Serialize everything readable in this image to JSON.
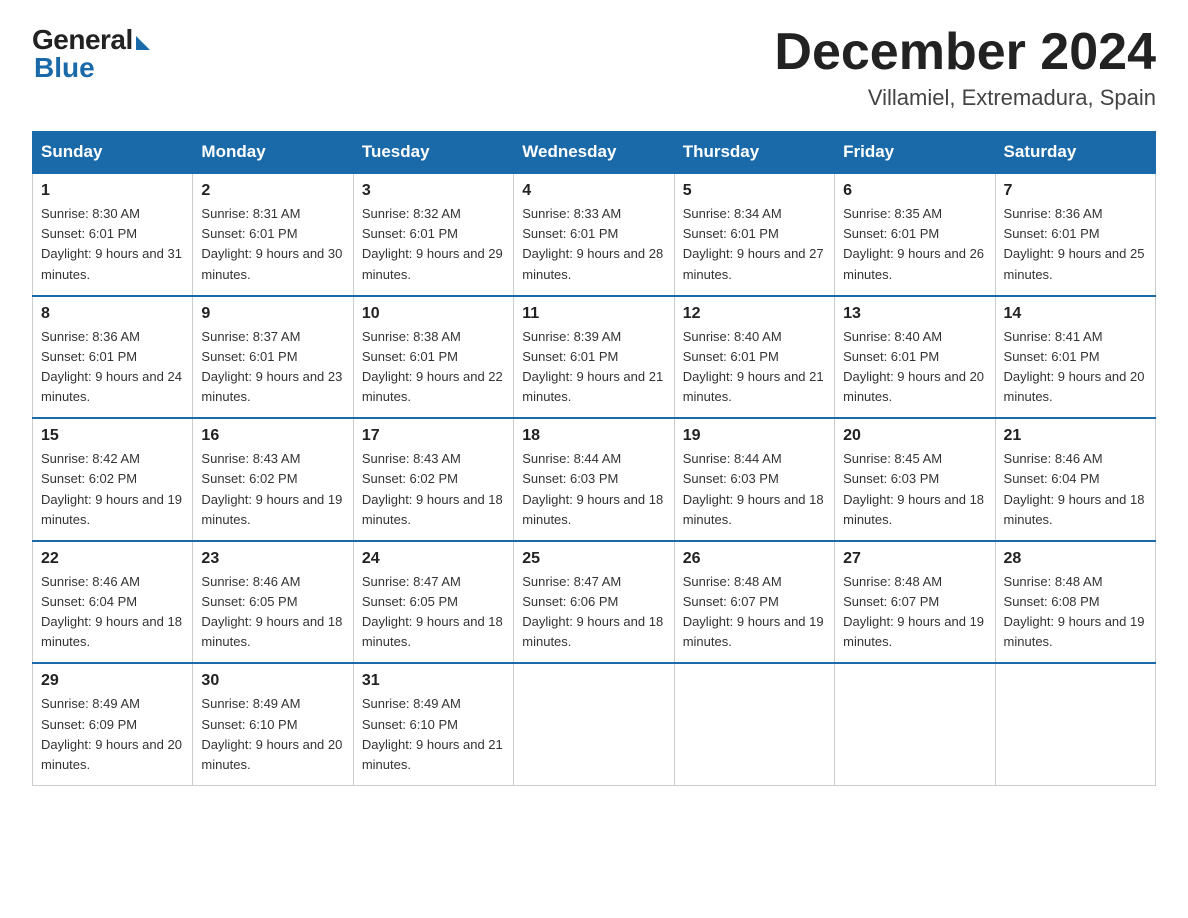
{
  "header": {
    "title": "December 2024",
    "subtitle": "Villamiel, Extremadura, Spain",
    "logo_general": "General",
    "logo_blue": "Blue"
  },
  "columns": [
    "Sunday",
    "Monday",
    "Tuesday",
    "Wednesday",
    "Thursday",
    "Friday",
    "Saturday"
  ],
  "weeks": [
    [
      {
        "day": "1",
        "info": "Sunrise: 8:30 AM\nSunset: 6:01 PM\nDaylight: 9 hours\nand 31 minutes."
      },
      {
        "day": "2",
        "info": "Sunrise: 8:31 AM\nSunset: 6:01 PM\nDaylight: 9 hours\nand 30 minutes."
      },
      {
        "day": "3",
        "info": "Sunrise: 8:32 AM\nSunset: 6:01 PM\nDaylight: 9 hours\nand 29 minutes."
      },
      {
        "day": "4",
        "info": "Sunrise: 8:33 AM\nSunset: 6:01 PM\nDaylight: 9 hours\nand 28 minutes."
      },
      {
        "day": "5",
        "info": "Sunrise: 8:34 AM\nSunset: 6:01 PM\nDaylight: 9 hours\nand 27 minutes."
      },
      {
        "day": "6",
        "info": "Sunrise: 8:35 AM\nSunset: 6:01 PM\nDaylight: 9 hours\nand 26 minutes."
      },
      {
        "day": "7",
        "info": "Sunrise: 8:36 AM\nSunset: 6:01 PM\nDaylight: 9 hours\nand 25 minutes."
      }
    ],
    [
      {
        "day": "8",
        "info": "Sunrise: 8:36 AM\nSunset: 6:01 PM\nDaylight: 9 hours\nand 24 minutes."
      },
      {
        "day": "9",
        "info": "Sunrise: 8:37 AM\nSunset: 6:01 PM\nDaylight: 9 hours\nand 23 minutes."
      },
      {
        "day": "10",
        "info": "Sunrise: 8:38 AM\nSunset: 6:01 PM\nDaylight: 9 hours\nand 22 minutes."
      },
      {
        "day": "11",
        "info": "Sunrise: 8:39 AM\nSunset: 6:01 PM\nDaylight: 9 hours\nand 21 minutes."
      },
      {
        "day": "12",
        "info": "Sunrise: 8:40 AM\nSunset: 6:01 PM\nDaylight: 9 hours\nand 21 minutes."
      },
      {
        "day": "13",
        "info": "Sunrise: 8:40 AM\nSunset: 6:01 PM\nDaylight: 9 hours\nand 20 minutes."
      },
      {
        "day": "14",
        "info": "Sunrise: 8:41 AM\nSunset: 6:01 PM\nDaylight: 9 hours\nand 20 minutes."
      }
    ],
    [
      {
        "day": "15",
        "info": "Sunrise: 8:42 AM\nSunset: 6:02 PM\nDaylight: 9 hours\nand 19 minutes."
      },
      {
        "day": "16",
        "info": "Sunrise: 8:43 AM\nSunset: 6:02 PM\nDaylight: 9 hours\nand 19 minutes."
      },
      {
        "day": "17",
        "info": "Sunrise: 8:43 AM\nSunset: 6:02 PM\nDaylight: 9 hours\nand 18 minutes."
      },
      {
        "day": "18",
        "info": "Sunrise: 8:44 AM\nSunset: 6:03 PM\nDaylight: 9 hours\nand 18 minutes."
      },
      {
        "day": "19",
        "info": "Sunrise: 8:44 AM\nSunset: 6:03 PM\nDaylight: 9 hours\nand 18 minutes."
      },
      {
        "day": "20",
        "info": "Sunrise: 8:45 AM\nSunset: 6:03 PM\nDaylight: 9 hours\nand 18 minutes."
      },
      {
        "day": "21",
        "info": "Sunrise: 8:46 AM\nSunset: 6:04 PM\nDaylight: 9 hours\nand 18 minutes."
      }
    ],
    [
      {
        "day": "22",
        "info": "Sunrise: 8:46 AM\nSunset: 6:04 PM\nDaylight: 9 hours\nand 18 minutes."
      },
      {
        "day": "23",
        "info": "Sunrise: 8:46 AM\nSunset: 6:05 PM\nDaylight: 9 hours\nand 18 minutes."
      },
      {
        "day": "24",
        "info": "Sunrise: 8:47 AM\nSunset: 6:05 PM\nDaylight: 9 hours\nand 18 minutes."
      },
      {
        "day": "25",
        "info": "Sunrise: 8:47 AM\nSunset: 6:06 PM\nDaylight: 9 hours\nand 18 minutes."
      },
      {
        "day": "26",
        "info": "Sunrise: 8:48 AM\nSunset: 6:07 PM\nDaylight: 9 hours\nand 19 minutes."
      },
      {
        "day": "27",
        "info": "Sunrise: 8:48 AM\nSunset: 6:07 PM\nDaylight: 9 hours\nand 19 minutes."
      },
      {
        "day": "28",
        "info": "Sunrise: 8:48 AM\nSunset: 6:08 PM\nDaylight: 9 hours\nand 19 minutes."
      }
    ],
    [
      {
        "day": "29",
        "info": "Sunrise: 8:49 AM\nSunset: 6:09 PM\nDaylight: 9 hours\nand 20 minutes."
      },
      {
        "day": "30",
        "info": "Sunrise: 8:49 AM\nSunset: 6:10 PM\nDaylight: 9 hours\nand 20 minutes."
      },
      {
        "day": "31",
        "info": "Sunrise: 8:49 AM\nSunset: 6:10 PM\nDaylight: 9 hours\nand 21 minutes."
      },
      {
        "day": "",
        "info": ""
      },
      {
        "day": "",
        "info": ""
      },
      {
        "day": "",
        "info": ""
      },
      {
        "day": "",
        "info": ""
      }
    ]
  ]
}
